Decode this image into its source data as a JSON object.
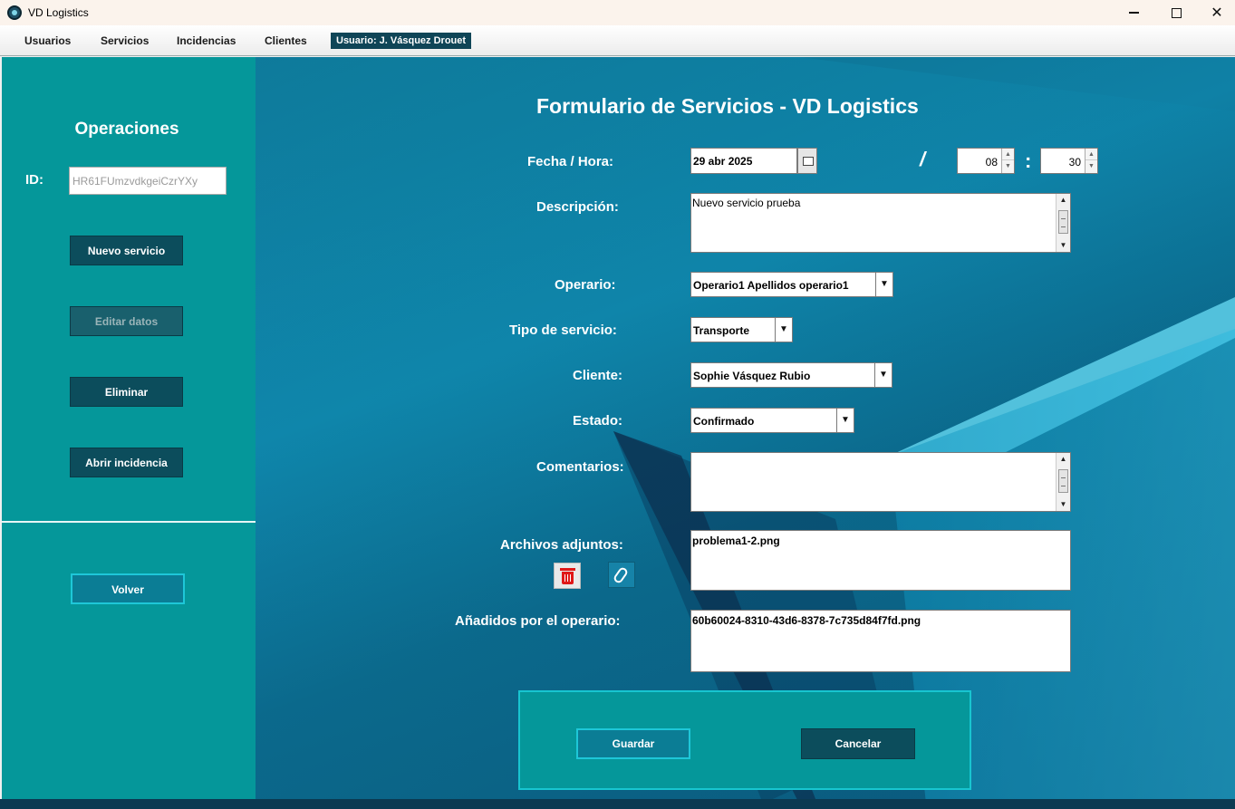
{
  "window": {
    "title": "VD Logistics"
  },
  "menu": {
    "items": [
      "Usuarios",
      "Servicios",
      "Incidencias",
      "Clientes"
    ],
    "user_badge": "Usuario: J. Vásquez Drouet"
  },
  "sidebar": {
    "heading": "Operaciones",
    "id_label": "ID:",
    "id_value": "HR61FUmzvdkgeiCzrYXy",
    "buttons": {
      "new": "Nuevo servicio",
      "edit": "Editar datos",
      "delete": "Eliminar",
      "incident": "Abrir incidencia",
      "back": "Volver"
    }
  },
  "form": {
    "title": "Formulario de Servicios - VD Logistics",
    "labels": {
      "datetime": "Fecha / Hora:",
      "description": "Descripción:",
      "operator": "Operario:",
      "service_type": "Tipo de servicio:",
      "client": "Cliente:",
      "status": "Estado:",
      "comments": "Comentarios:",
      "attachments": "Archivos adjuntos:",
      "operator_added": "Añadidos por el operario:"
    },
    "date": "29 abr 2025",
    "date_separator": "/",
    "time_separator": ":",
    "hour": "08",
    "minute": "30",
    "description": "Nuevo servicio prueba",
    "operator": "Operario1 Apellidos operario1",
    "service_type": "Transporte",
    "client": "Sophie Vásquez Rubio",
    "status": "Confirmado",
    "comments": "",
    "attachments": [
      "problema1-2.png"
    ],
    "operator_files": [
      "60b60024-8310-43d6-8378-7c735d84f7fd.png"
    ],
    "actions": {
      "save": "Guardar",
      "cancel": "Cancelar"
    }
  },
  "colors": {
    "sidebar": "#05979a",
    "dark_button": "#0c4d5c",
    "accent_button": "#0b7d95",
    "main_bg": "#0f81a6"
  },
  "icons": [
    "app-logo-icon",
    "calendar-icon",
    "trash-icon",
    "paperclip-icon"
  ]
}
